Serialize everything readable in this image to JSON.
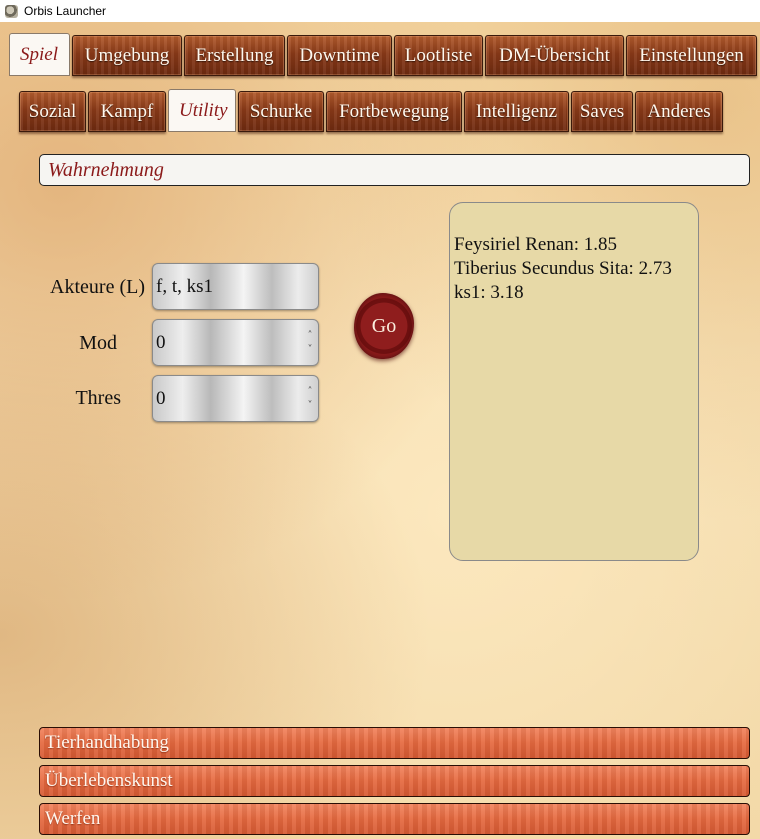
{
  "window": {
    "title": "Orbis Launcher",
    "icon": "app-icon"
  },
  "main_tabs": [
    {
      "label": "Spiel",
      "active": true
    },
    {
      "label": "Umgebung",
      "active": false
    },
    {
      "label": "Erstellung",
      "active": false
    },
    {
      "label": "Downtime",
      "active": false
    },
    {
      "label": "Lootliste",
      "active": false
    },
    {
      "label": "DM-Übersicht",
      "active": false
    },
    {
      "label": "Einstellungen",
      "active": false
    }
  ],
  "sub_tabs": [
    {
      "label": "Sozial",
      "active": false
    },
    {
      "label": "Kampf",
      "active": false
    },
    {
      "label": "Utility",
      "active": true
    },
    {
      "label": "Schurke",
      "active": false
    },
    {
      "label": "Fortbewegung",
      "active": false
    },
    {
      "label": "Intelligenz",
      "active": false
    },
    {
      "label": "Saves",
      "active": false
    },
    {
      "label": "Anderes",
      "active": false
    }
  ],
  "search": {
    "value": "Wahrnehmung"
  },
  "form": {
    "actors_label": "Akteure (L)",
    "actors_value": "f, t, ks1",
    "mod_label": "Mod",
    "mod_value": "0",
    "thres_label": "Thres",
    "thres_value": "0",
    "go_label": "Go"
  },
  "output": {
    "lines": [
      "Feysiriel Renan: 1.85",
      "Tiberius Secundus Sita: 2.73",
      "ks1: 3.18"
    ]
  },
  "sections": [
    {
      "label": "Tierhandhabung"
    },
    {
      "label": "Überlebenskunst"
    },
    {
      "label": "Werfen"
    }
  ],
  "colors": {
    "accent_text": "#8b1a1a",
    "tab_wood": "#8a3a18",
    "section_wood": "#e5693f",
    "output_bg": "#e7d9a7",
    "seal": "#8f1d1d"
  }
}
